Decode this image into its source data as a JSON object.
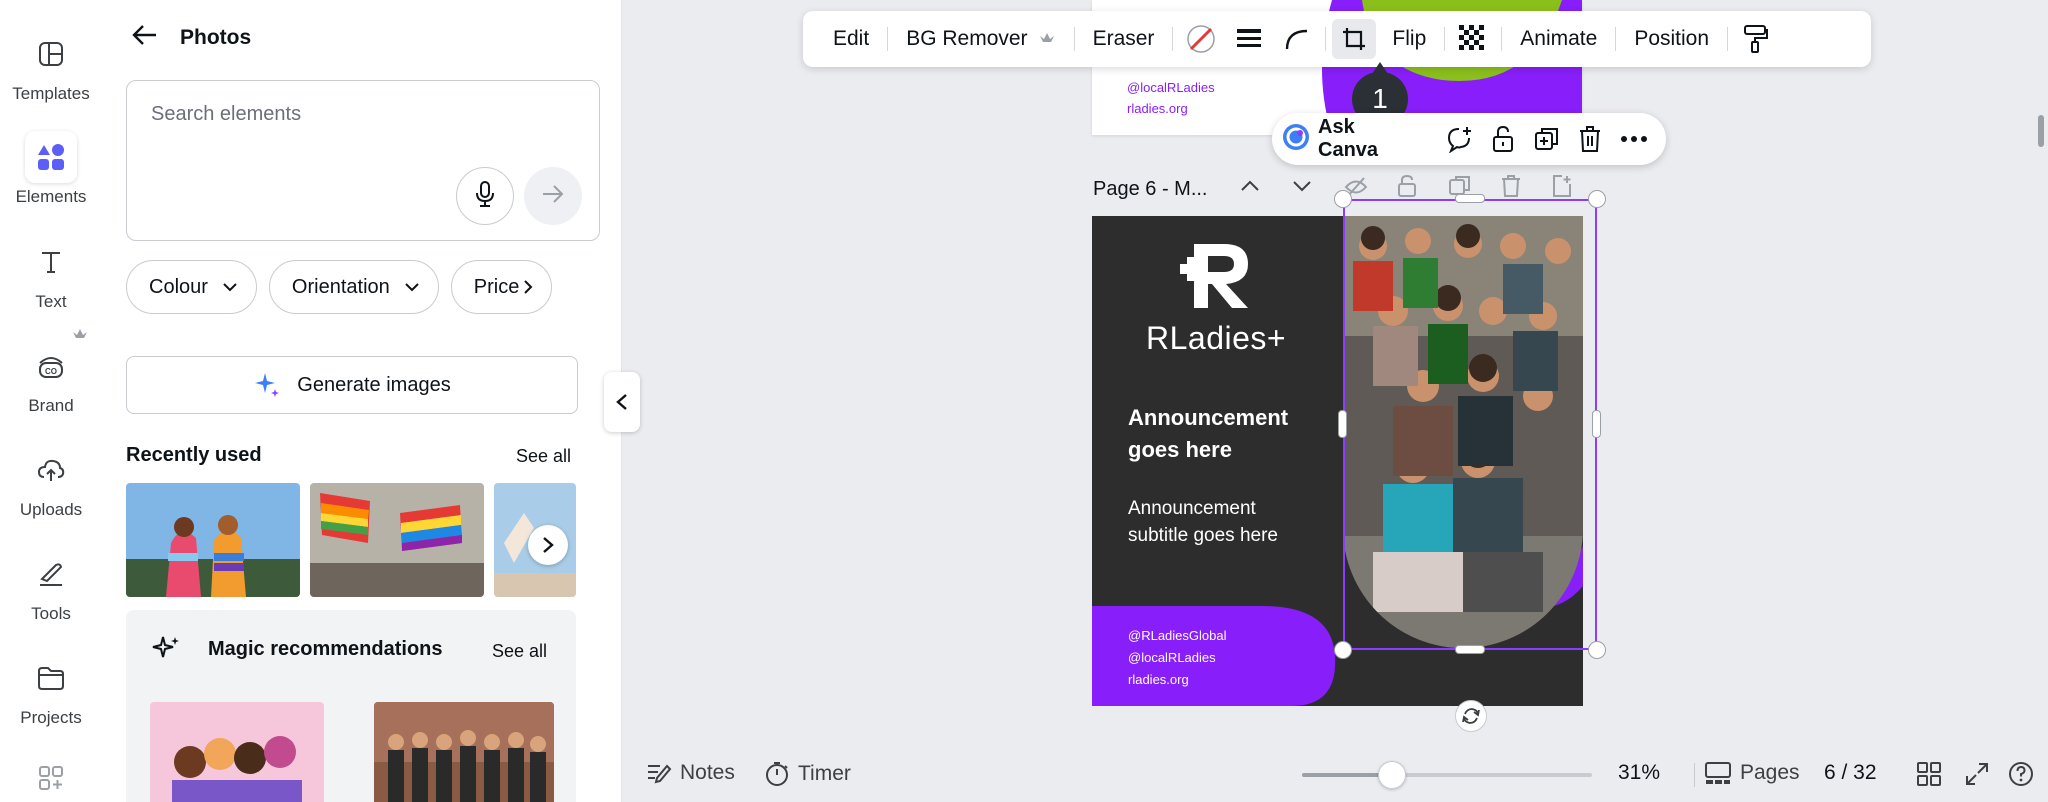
{
  "rail": {
    "items": [
      {
        "label": "Templates",
        "icon": "templates-icon"
      },
      {
        "label": "Elements",
        "icon": "elements-icon"
      },
      {
        "label": "Text",
        "icon": "text-icon"
      },
      {
        "label": "Brand",
        "icon": "brand-icon"
      },
      {
        "label": "Uploads",
        "icon": "uploads-icon"
      },
      {
        "label": "Tools",
        "icon": "tools-icon"
      },
      {
        "label": "Projects",
        "icon": "projects-icon"
      }
    ]
  },
  "panel": {
    "title": "Photos",
    "search_placeholder": "Search elements",
    "filters": [
      "Colour",
      "Orientation",
      "Price"
    ],
    "generate_label": "Generate images",
    "recent_title": "Recently used",
    "recent_see_all": "See all",
    "magic_title": "Magic recommendations",
    "magic_see_all": "See all"
  },
  "toolbar": {
    "edit": "Edit",
    "bg_remover": "BG Remover",
    "eraser": "Eraser",
    "flip": "Flip",
    "animate": "Animate",
    "position": "Position",
    "crop_tooltip": "1"
  },
  "context_menu": {
    "ask_canva": "Ask Canva"
  },
  "canvas": {
    "page_label": "Page 6 - M...",
    "prev_page_handles": [
      "@localRLadies",
      "rladies.org"
    ],
    "design": {
      "logo_text": "RLadies+",
      "headline_line1": "Announcement",
      "headline_line2": "goes here",
      "subtitle_line1": "Announcement",
      "subtitle_line2": "subtitle goes here",
      "handles": [
        "@RLadiesGlobal",
        "@localRLadies",
        "rladies.org"
      ]
    }
  },
  "bottom_bar": {
    "notes": "Notes",
    "timer": "Timer",
    "zoom": "31%",
    "zoom_level": 0.31,
    "pages": "Pages",
    "page_counter": "6 / 32"
  },
  "colors": {
    "accent": "#8b3dff",
    "design_dark": "#2d2d2d",
    "design_purple": "#881ef9",
    "strip_green": "#8bbf1b"
  }
}
